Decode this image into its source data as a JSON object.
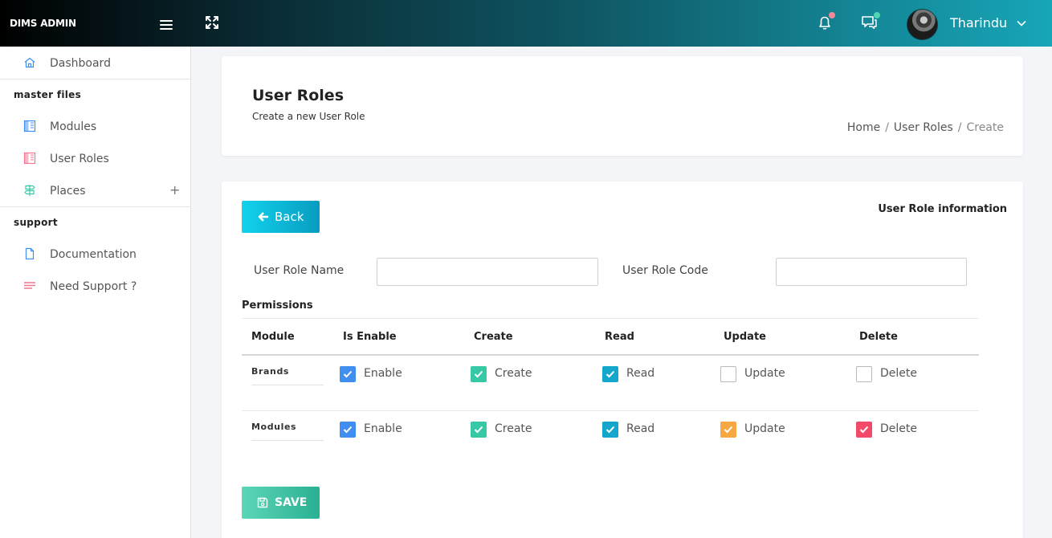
{
  "topbar": {
    "brand": "DIMS ADMIN",
    "username": "Tharindu",
    "notification_dot_color": "#f08a9b",
    "message_dot_color": "#4fd6b0"
  },
  "sidebar": {
    "items": [
      {
        "label": "Dashboard",
        "icon": "home-icon"
      },
      {
        "label": "Modules",
        "icon": "columns-icon"
      },
      {
        "label": "User Roles",
        "icon": "columns-icon"
      },
      {
        "label": "Places",
        "icon": "signpost-icon"
      },
      {
        "label": "Documentation",
        "icon": "document-icon"
      },
      {
        "label": "Need Support ?",
        "icon": "lines-icon"
      }
    ],
    "sections": {
      "master": "master files",
      "support": "support"
    },
    "places_expand": "+"
  },
  "header": {
    "title": "User Roles",
    "subtitle": "Create a new User Role",
    "breadcrumb": [
      "Home",
      "User Roles",
      "Create"
    ],
    "separator": "/"
  },
  "form": {
    "back_label": "Back",
    "section_title": "User Role information",
    "role_name_label": "User Role Name",
    "role_name_value": "",
    "role_code_label": "User Role Code",
    "role_code_value": "",
    "permissions_title": "Permissions",
    "save_label": "SAVE"
  },
  "permissions": {
    "columns": [
      "Module",
      "Is Enable",
      "Create",
      "Read",
      "Update",
      "Delete"
    ],
    "rows": [
      {
        "module": "Brands",
        "enable": {
          "label": "Enable",
          "checked": true
        },
        "create": {
          "label": "Create",
          "checked": true
        },
        "read": {
          "label": "Read",
          "checked": true
        },
        "update": {
          "label": "Update",
          "checked": false
        },
        "delete": {
          "label": "Delete",
          "checked": false
        }
      },
      {
        "module": "Modules",
        "enable": {
          "label": "Enable",
          "checked": true
        },
        "create": {
          "label": "Create",
          "checked": true
        },
        "read": {
          "label": "Read",
          "checked": true
        },
        "update": {
          "label": "Update",
          "checked": true
        },
        "delete": {
          "label": "Delete",
          "checked": true
        }
      }
    ],
    "colors": {
      "enable": "#3f8ef0",
      "create": "#37c9a6",
      "read": "#13a7cc",
      "update": "#f7a843",
      "delete": "#f44a6a"
    }
  },
  "colors": {
    "accent": "#17a6b8",
    "back_button": "#11d2ec",
    "save_button": "#3cc4a2"
  }
}
